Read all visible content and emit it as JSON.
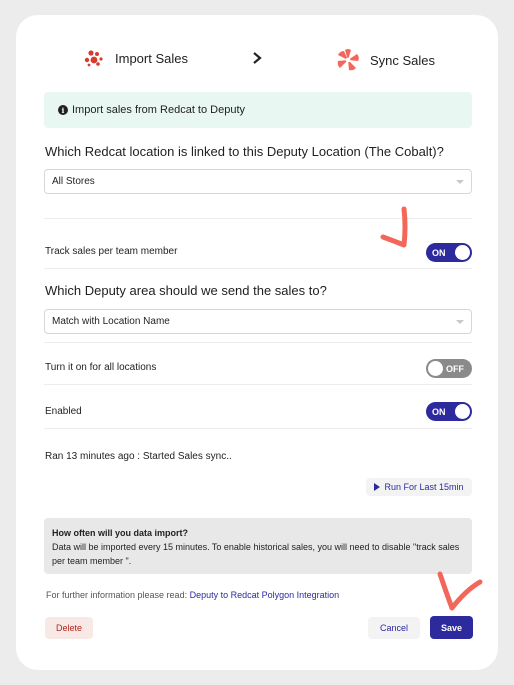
{
  "steps": {
    "import_label": "Import Sales",
    "sync_label": "Sync Sales",
    "separator_icon": "chevron-right-icon"
  },
  "info_banner": {
    "text": "Import sales from Redcat to Deputy",
    "icon": "info-icon"
  },
  "location_section": {
    "question": "Which Redcat location is linked to this Deputy Location (The Cobalt)?",
    "selected": "All Stores"
  },
  "track_sales": {
    "label": "Track sales per team member",
    "toggle": "ON"
  },
  "area_section": {
    "question": "Which Deputy area should we send the sales to?",
    "selected": "Match with Location Name"
  },
  "all_locations": {
    "label": "Turn it on for all locations",
    "toggle": "OFF"
  },
  "enabled": {
    "label": "Enabled",
    "toggle": "ON"
  },
  "status": {
    "text": "Ran 13 minutes ago : Started Sales sync.."
  },
  "run_button": {
    "label": "Run For Last 15min"
  },
  "note": {
    "title": "How often will you data import?",
    "body": "Data will be imported every 15 minutes. To enable historical sales, you will need to disable \"track sales per team member \"."
  },
  "further": {
    "prefix": "For further information please read:",
    "link_text": "Deputy to Redcat Polygon Integration"
  },
  "footer": {
    "delete_label": "Delete",
    "cancel_label": "Cancel",
    "save_label": "Save"
  },
  "colors": {
    "accent": "#2d2a9e",
    "annotation": "#f2675a",
    "info_bg": "#e9f7f2",
    "danger": "#b0281f"
  }
}
